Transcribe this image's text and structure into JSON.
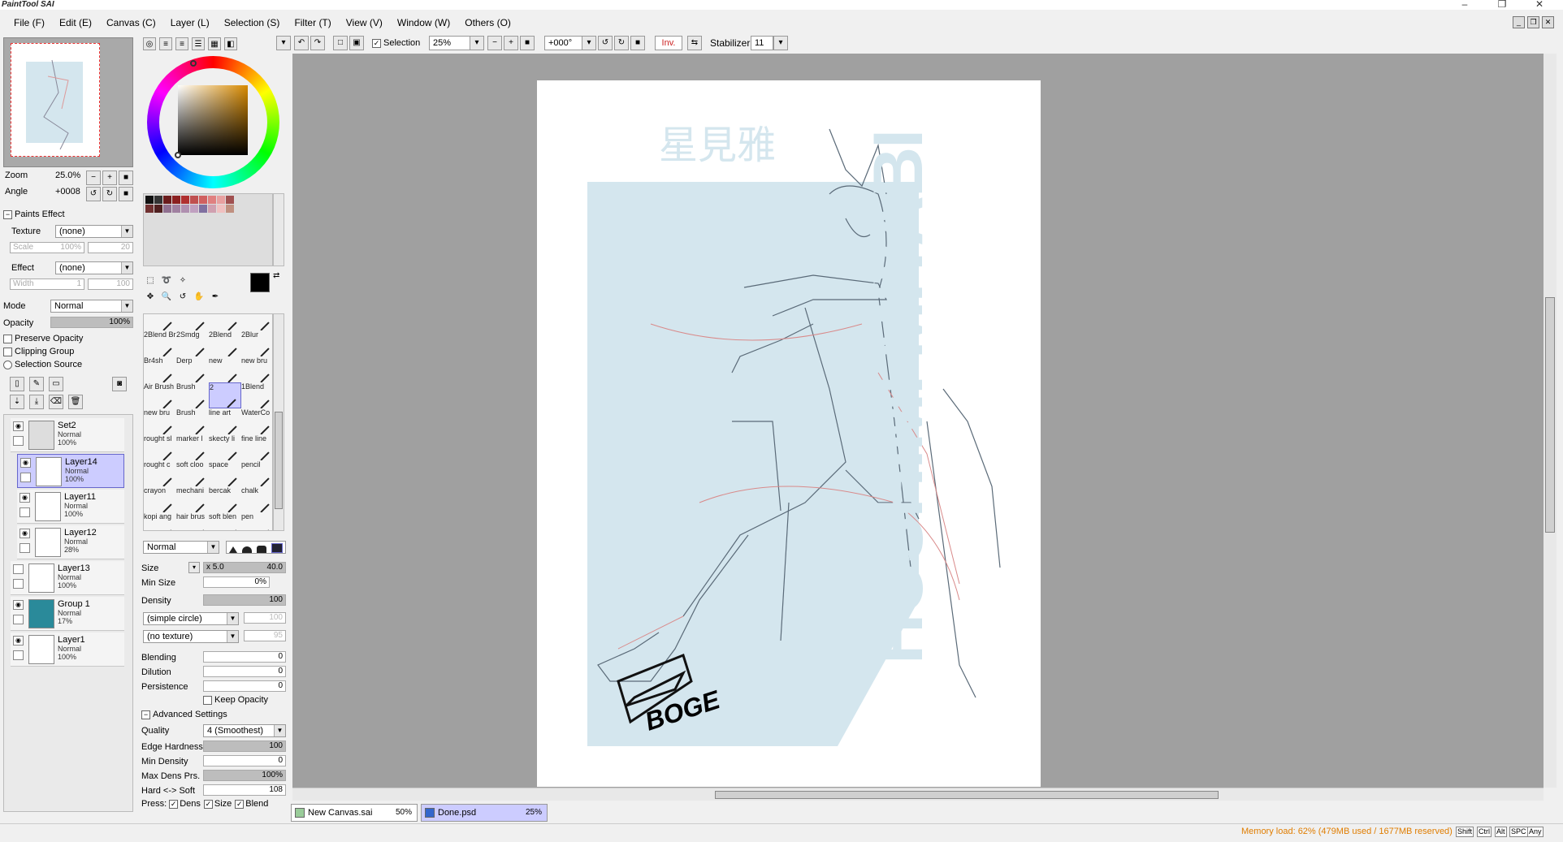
{
  "app": {
    "title": "PaintTool SAI"
  },
  "menu": [
    "File (F)",
    "Edit (E)",
    "Canvas (C)",
    "Layer (L)",
    "Selection (S)",
    "Filter (T)",
    "View (V)",
    "Window (W)",
    "Others (O)"
  ],
  "toolbar": {
    "selection_label": "Selection",
    "selection_checked": true,
    "zoom_value": "25%",
    "rotation_value": "+000°",
    "invert_label": "Inv.",
    "stabilizer_label": "Stabilizer",
    "stabilizer_value": "11"
  },
  "navigator": {
    "zoom_label": "Zoom",
    "zoom_value": "25.0%",
    "angle_label": "Angle",
    "angle_value": "+0008"
  },
  "paints_effect": {
    "header": "Paints Effect",
    "texture_label": "Texture",
    "texture_value": "(none)",
    "scale_label": "Scale",
    "scale_value": "100%",
    "scale_num": "20",
    "effect_label": "Effect",
    "effect_value": "(none)",
    "width_label": "Width",
    "width_value": "1",
    "width_num": "100"
  },
  "layer_props": {
    "mode_label": "Mode",
    "mode_value": "Normal",
    "opacity_label": "Opacity",
    "opacity_value": "100%",
    "opacity_level": 1.0,
    "preserve_opacity": "Preserve Opacity",
    "clipping_group": "Clipping Group",
    "selection_source": "Selection Source"
  },
  "layers": [
    {
      "name": "Set2",
      "mode": "Normal",
      "opacity": "100%",
      "visible": true,
      "selected": false,
      "type": "folder"
    },
    {
      "name": "Layer14",
      "mode": "Normal",
      "opacity": "100%",
      "visible": true,
      "selected": true,
      "type": "layer"
    },
    {
      "name": "Layer11",
      "mode": "Normal",
      "opacity": "100%",
      "visible": true,
      "selected": false,
      "type": "layer"
    },
    {
      "name": "Layer12",
      "mode": "Normal",
      "opacity": "28%",
      "visible": true,
      "selected": false,
      "type": "layer"
    },
    {
      "name": "Layer13",
      "mode": "Normal",
      "opacity": "100%",
      "visible": false,
      "selected": false,
      "type": "layer"
    },
    {
      "name": "Group 1",
      "mode": "Normal",
      "opacity": "17%",
      "visible": true,
      "selected": false,
      "type": "group"
    },
    {
      "name": "Layer1",
      "mode": "Normal",
      "opacity": "100%",
      "visible": true,
      "selected": false,
      "type": "layer"
    }
  ],
  "brushes": [
    [
      "Brush",
      "",
      "",
      ""
    ],
    [
      "2Blend Brush",
      "2Smdg",
      "2Blend",
      "2Blur"
    ],
    [
      "Br4sh",
      "Derp",
      "new",
      "new bru"
    ],
    [
      "Air Brush",
      "Brush",
      "2",
      "1Blend"
    ],
    [
      "new bru",
      "Brush",
      "line art",
      "WaterCo"
    ],
    [
      "rought sl",
      "marker l",
      "skecty li",
      "fine line"
    ],
    [
      "rought c",
      "soft cloo",
      "space",
      "pencil"
    ],
    [
      "crayon",
      "mechani",
      "bercak",
      "chalk"
    ],
    [
      "kopi ang",
      "hair brus",
      "soft blen",
      "pen"
    ]
  ],
  "brush_settings": {
    "blend_mode": "Normal",
    "size_label": "Size",
    "size_mult": "x 5.0",
    "size_value": "40.0",
    "min_size_label": "Min Size",
    "min_size_value": "0%",
    "density_label": "Density",
    "density_value": "100",
    "shape_value": "(simple circle)",
    "shape_num": "100",
    "texture_value": "(no texture)",
    "texture_num": "95",
    "blending_label": "Blending",
    "blending_value": "0",
    "dilution_label": "Dilution",
    "dilution_value": "0",
    "persistence_label": "Persistence",
    "persistence_value": "0",
    "keep_opacity": "Keep Opacity",
    "advanced_header": "Advanced Settings",
    "quality_label": "Quality",
    "quality_value": "4 (Smoothest)",
    "edge_hardness_label": "Edge Hardness",
    "edge_hardness_value": "100",
    "min_density_label": "Min Density",
    "min_density_value": "0",
    "max_dens_label": "Max Dens Prs.",
    "max_dens_value": "100%",
    "hard_soft_label": "Hard <-> Soft",
    "hard_soft_value": "108",
    "press_label": "Press:",
    "press_dens": "Dens",
    "press_size": "Size",
    "press_blend": "Blend"
  },
  "canvas": {
    "artwork_text_vertical": "HOSHIMI MIYABI",
    "artwork_text_cjk": "星見雅",
    "signature": "BOGE"
  },
  "documents": [
    {
      "name": "New Canvas.sai",
      "zoom": "50%",
      "active": false
    },
    {
      "name": "Done.psd",
      "zoom": "25%",
      "active": true
    }
  ],
  "status": {
    "memory": "Memory load: 62% (479MB used / 1677MB reserved)",
    "keys": [
      "Shift",
      "Ctrl",
      "Alt",
      "SPC",
      "Any"
    ]
  },
  "colors": {
    "accent_select": "#ccccff",
    "canvas_bg": "#a0a0a0",
    "artwork_blue": "#d4e6ee",
    "memory_text": "#e07d00"
  }
}
